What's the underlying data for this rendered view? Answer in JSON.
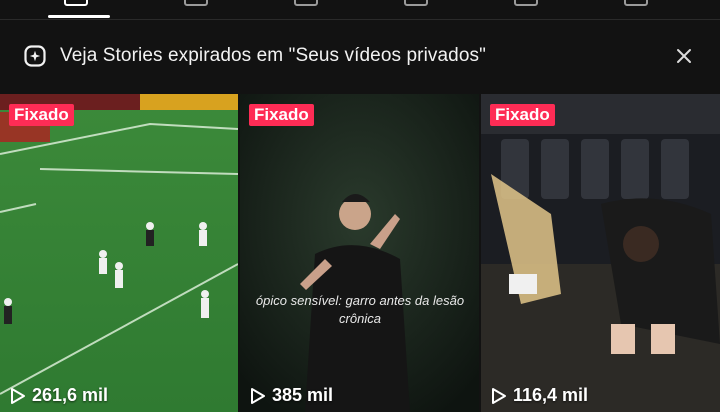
{
  "banner": {
    "text": "Veja Stories expirados em \"Seus vídeos privados\"",
    "icon": "sparkle-plus-icon",
    "close_icon": "close-icon"
  },
  "colors": {
    "background": "#121212",
    "pin_badge": "#fe2c55",
    "text": "#ffffff"
  },
  "videos": [
    {
      "badge": "Fixado",
      "views": "261,6 mil"
    },
    {
      "badge": "Fixado",
      "views": "385 mil",
      "caption_line1": "ópico sensível: garro antes da lesão",
      "caption_line2": "crônica"
    },
    {
      "badge": "Fixado",
      "views": "116,4 mil"
    }
  ]
}
